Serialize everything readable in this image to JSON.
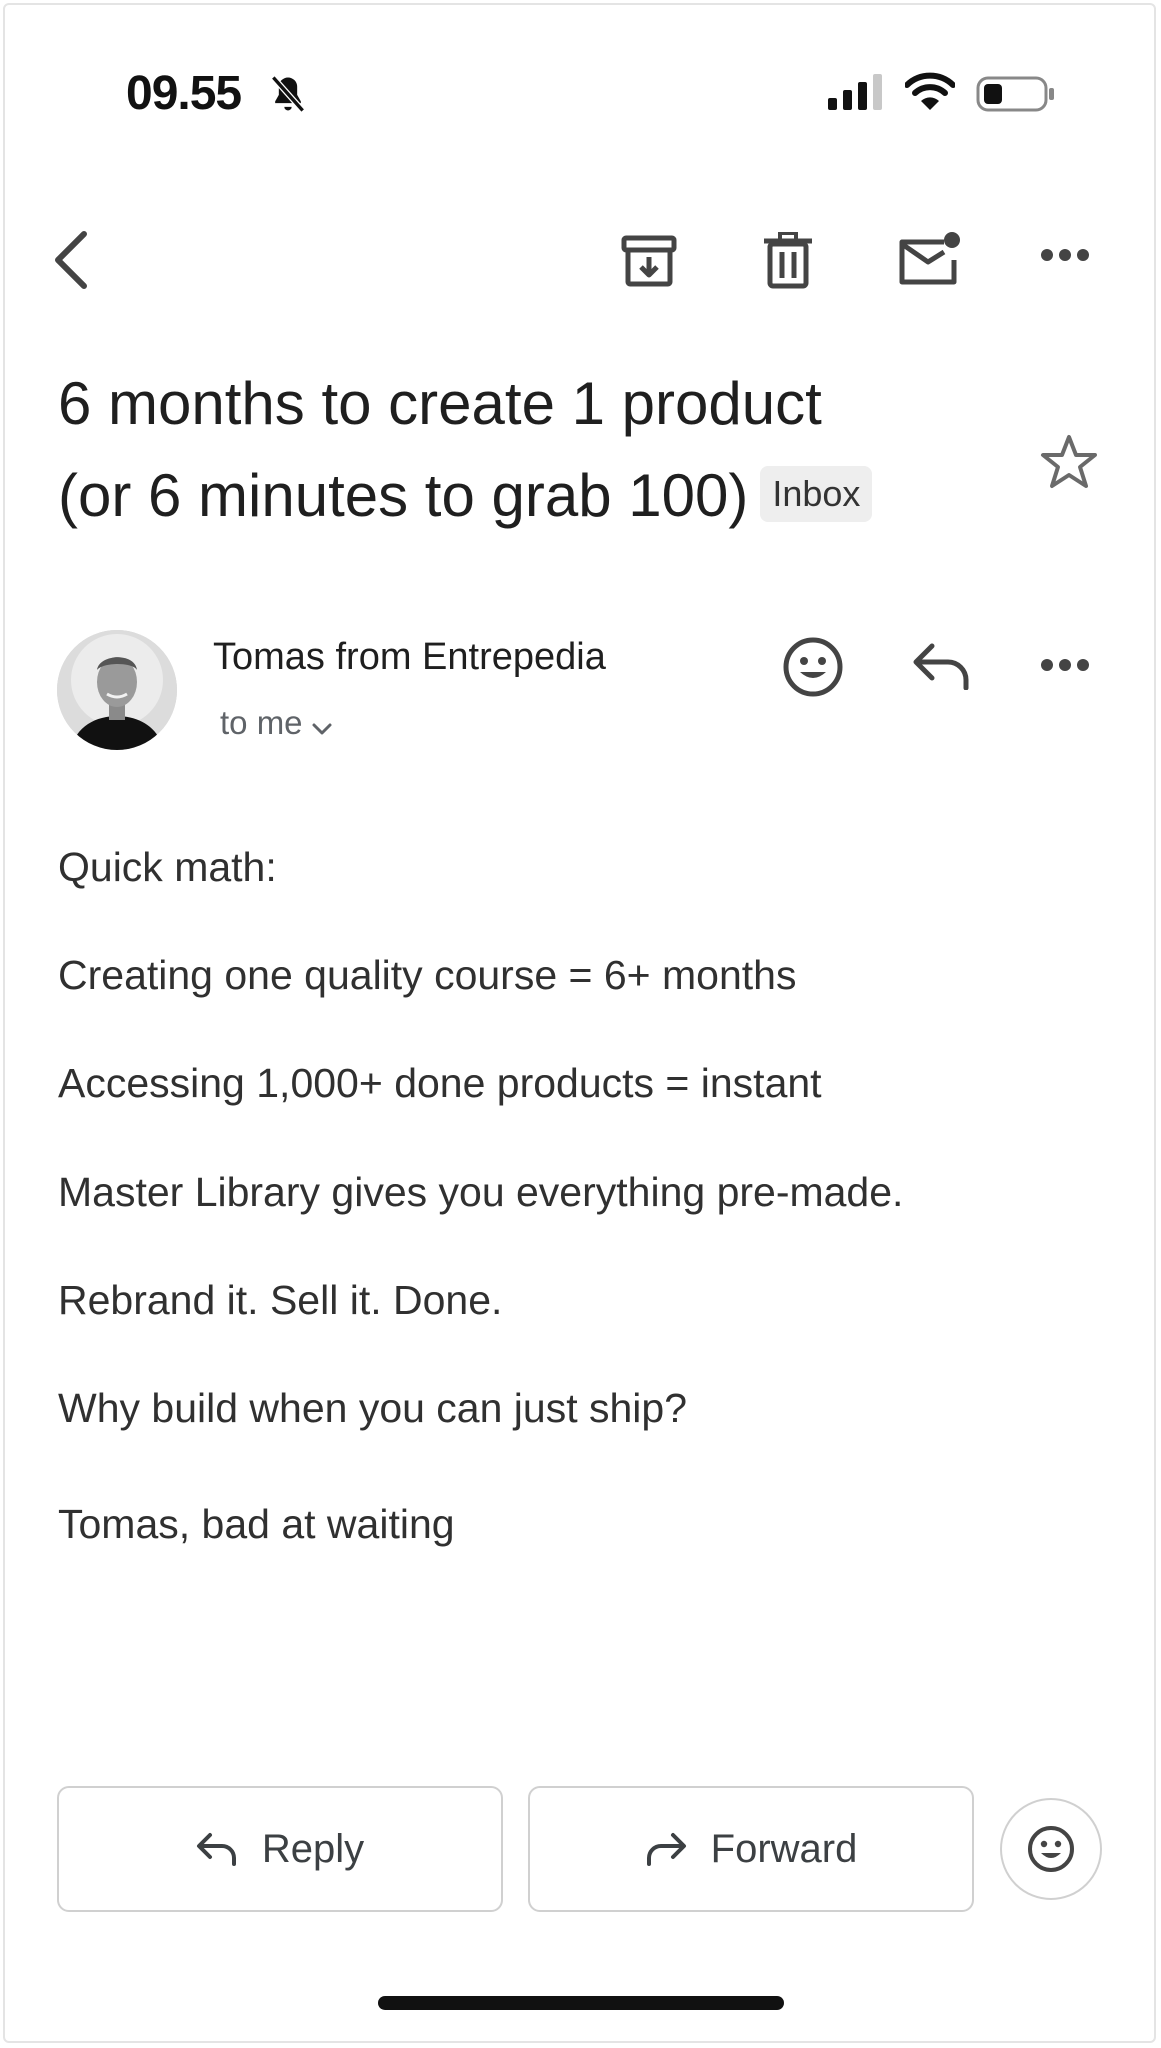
{
  "status_bar": {
    "time": "09.55"
  },
  "toolbar": {
    "icons": [
      "back-icon",
      "archive-icon",
      "trash-icon",
      "mark-unread-icon",
      "more-icon"
    ]
  },
  "email": {
    "subject_line1": "6 months to create 1 product",
    "subject_line2": "(or 6 minutes to grab 100)",
    "label": "Inbox",
    "sender": "Tomas from Entrepedia",
    "recipient": "to me",
    "body": [
      "Quick math:",
      "Creating one quality course = 6+ months",
      "Accessing 1,000+ done products = instant",
      "Master Library gives you everything pre-made.",
      "Rebrand it. Sell it. Done.",
      "Why build when you can just ship?",
      "Tomas, bad at waiting"
    ]
  },
  "actions": {
    "reply_label": "Reply",
    "forward_label": "Forward"
  }
}
